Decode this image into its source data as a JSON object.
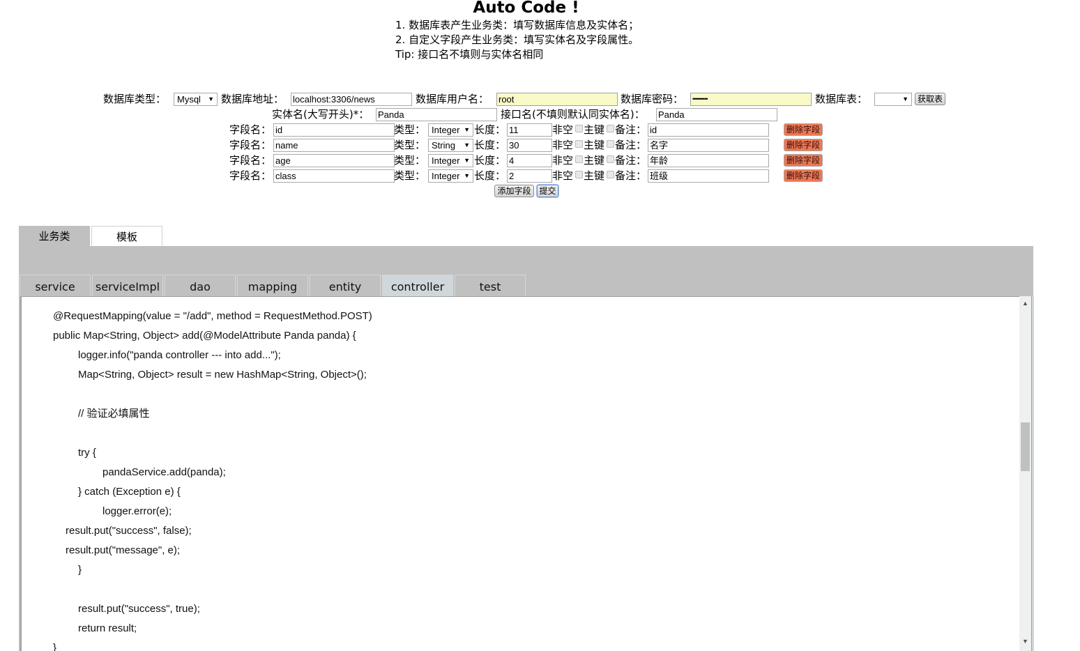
{
  "header": {
    "title": "Auto Code !",
    "instructions": [
      "1. 数据库表产生业务类：填写数据库信息及实体名；",
      "2. 自定义字段产生业务类：填写实体名及字段属性。",
      "Tip: 接口名不填则与实体名相同"
    ]
  },
  "db_form": {
    "db_type_label": "数据库类型：",
    "db_type_value": "Mysql",
    "db_url_label": "数据库地址：",
    "db_url_value": "localhost:3306/news",
    "db_user_label": "数据库用户名：",
    "db_user_value": "root",
    "db_password_label": "数据库密码：",
    "db_password_value": "••••••••••",
    "db_table_label": "数据库表：",
    "db_table_value": "",
    "fetch_tables_button": "获取表"
  },
  "entity_form": {
    "entity_name_label": "实体名(大写开头)*：",
    "entity_name_value": "Panda",
    "interface_name_label": "接口名(不填则默认同实体名)：",
    "interface_name_value": "Panda"
  },
  "field_labels": {
    "name": "字段名：",
    "type": "类型：",
    "length": "长度：",
    "not_null": "非空",
    "primary_key": "主键",
    "comment": "备注：",
    "delete_button": "删除字段"
  },
  "fields": [
    {
      "name": "id",
      "type": "Integer",
      "length": "11",
      "not_null": false,
      "primary_key": false,
      "comment": "id"
    },
    {
      "name": "name",
      "type": "String",
      "length": "30",
      "not_null": false,
      "primary_key": false,
      "comment": "名字"
    },
    {
      "name": "age",
      "type": "Integer",
      "length": "4",
      "not_null": false,
      "primary_key": false,
      "comment": "年龄"
    },
    {
      "name": "class",
      "type": "Integer",
      "length": "2",
      "not_null": false,
      "primary_key": false,
      "comment": "班级"
    }
  ],
  "actions": {
    "add_field_button": "添加字段",
    "submit_button": "提交"
  },
  "outer_tabs": [
    {
      "label": "业务类",
      "active": true
    },
    {
      "label": "模板",
      "active": false
    }
  ],
  "inner_tabs": [
    {
      "label": "service",
      "active": false
    },
    {
      "label": "serviceImpl",
      "active": false
    },
    {
      "label": "dao",
      "active": false
    },
    {
      "label": "mapping",
      "active": false
    },
    {
      "label": "entity",
      "active": false
    },
    {
      "label": "controller",
      "active": true
    },
    {
      "label": "test",
      "active": false
    }
  ],
  "code_lines": [
    "@RequestMapping(value = \"/add\", method = RequestMethod.POST)",
    "public Map<String, Object> add(@ModelAttribute Panda panda) {",
    "logger.info(\"panda controller --- into add...\");",
    "Map<String, Object> result = new HashMap<String, Object>();",
    "",
    "// 验证必填属性",
    "",
    "try {",
    "pandaService.add(panda);",
    "} catch (Exception e) {",
    "logger.error(e);",
    "result.put(\"success\", false);",
    "result.put(\"message\", e);",
    "}",
    "",
    "result.put(\"success\", true);",
    "return result;",
    "}"
  ]
}
